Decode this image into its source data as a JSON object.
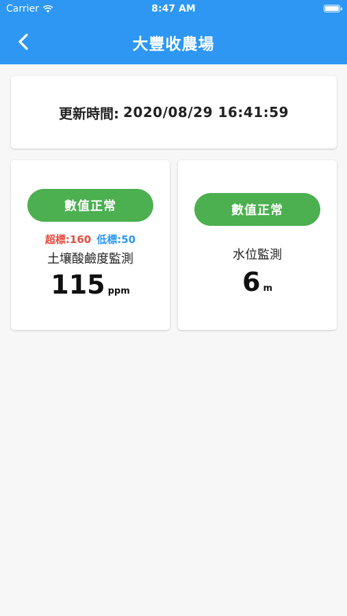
{
  "status_bar": {
    "carrier": "Carrier",
    "time": "8:47 AM"
  },
  "nav": {
    "title": "大豐收農場",
    "back_icon": "chevron-left-icon"
  },
  "update": {
    "label": "更新時間:",
    "value": "2020/08/29 16:41:59"
  },
  "sensors": [
    {
      "status": "數值正常",
      "threshold_high": "超標:160",
      "threshold_low": "低標:50",
      "name": "土壤酸鹼度監測",
      "value": "115",
      "unit": "ppm"
    },
    {
      "status": "數值正常",
      "name": "水位監測",
      "value": "6",
      "unit": "m"
    }
  ],
  "colors": {
    "header": "#2d97f3",
    "status_ok": "#4caf50",
    "threshold_high": "#e54a3c",
    "threshold_low": "#2d97f3",
    "background": "#f7f7f7"
  }
}
